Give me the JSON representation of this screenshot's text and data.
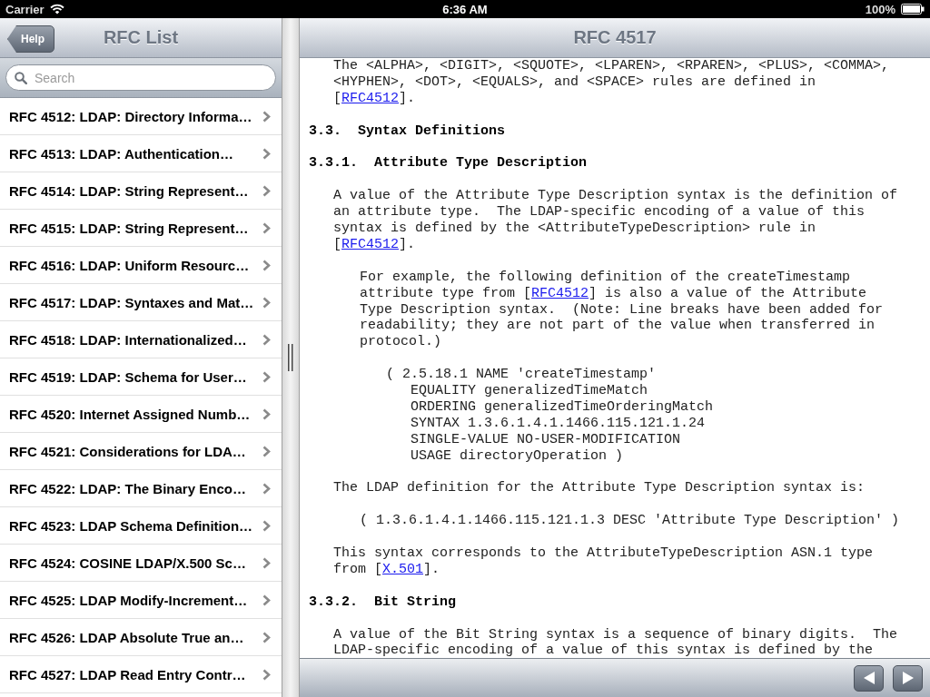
{
  "status_bar": {
    "carrier": "Carrier",
    "time": "6:36 AM",
    "battery": "100%"
  },
  "master": {
    "title": "RFC List",
    "back_button": "Help",
    "search": {
      "placeholder": "Search"
    },
    "items": [
      "RFC 4512: LDAP: Directory Informa…",
      "RFC 4513: LDAP: Authentication…",
      "RFC 4514: LDAP: String Represent…",
      "RFC 4515: LDAP: String Represent…",
      "RFC 4516: LDAP: Uniform Resourc…",
      "RFC 4517: LDAP: Syntaxes and Mat…",
      "RFC 4518: LDAP: Internationalized…",
      "RFC 4519: LDAP: Schema for User…",
      "RFC 4520: Internet Assigned Numb…",
      "RFC 4521: Considerations for LDA…",
      "RFC 4522: LDAP: The Binary Enco…",
      "RFC 4523: LDAP Schema Definition…",
      "RFC 4524: COSINE LDAP/X.500 Sc…",
      "RFC 4525: LDAP Modify-Increment…",
      "RFC 4526: LDAP Absolute True an…",
      "RFC 4527: LDAP Read Entry Contr…"
    ]
  },
  "detail": {
    "title": "RFC 4517",
    "blocks": [
      {
        "kind": "text",
        "parts": [
          {
            "text": "The <ALPHA>, <DIGIT>, <SQUOTE>, <LPAREN>, <RPAREN>, <PLUS>, <COMMA>,\n<HYPHEN>, <DOT>, <EQUALS>, and <SPACE> rules are defined in\n["
          },
          {
            "link": "RFC4512"
          },
          {
            "text": "]."
          }
        ]
      },
      {
        "kind": "heading",
        "parts": [
          {
            "text": "3.3.  Syntax Definitions"
          }
        ]
      },
      {
        "kind": "heading",
        "parts": [
          {
            "text": "3.3.1.  Attribute Type Description"
          }
        ]
      },
      {
        "kind": "text",
        "parts": [
          {
            "text": "A value of the Attribute Type Description syntax is the definition of\nan attribute type.  The LDAP-specific encoding of a value of this\nsyntax is defined by the <AttributeTypeDescription> rule in\n["
          },
          {
            "link": "RFC4512"
          },
          {
            "text": "]."
          }
        ]
      },
      {
        "kind": "note",
        "parts": [
          {
            "text": "For example, the following definition of the createTimestamp\nattribute type from ["
          },
          {
            "link": "RFC4512"
          },
          {
            "text": "] is also a value of the Attribute\nType Description syntax.  (Note: Line breaks have been added for\nreadability; they are not part of the value when transferred in\nprotocol.)"
          }
        ]
      },
      {
        "kind": "example",
        "parts": [
          {
            "text": "( 2.5.18.1 NAME 'createTimestamp'\n   EQUALITY generalizedTimeMatch\n   ORDERING generalizedTimeOrderingMatch\n   SYNTAX 1.3.6.1.4.1.1466.115.121.1.24\n   SINGLE-VALUE NO-USER-MODIFICATION\n   USAGE directoryOperation )"
          }
        ]
      },
      {
        "kind": "text",
        "parts": [
          {
            "text": "The LDAP definition for the Attribute Type Description syntax is:"
          }
        ]
      },
      {
        "kind": "note",
        "parts": [
          {
            "text": "( 1.3.6.1.4.1.1466.115.121.1.3 DESC 'Attribute Type Description' )"
          }
        ]
      },
      {
        "kind": "text",
        "parts": [
          {
            "text": "This syntax corresponds to the AttributeTypeDescription ASN.1 type\nfrom ["
          },
          {
            "link": "X.501"
          },
          {
            "text": "]."
          }
        ]
      },
      {
        "kind": "heading",
        "parts": [
          {
            "text": "3.3.2.  Bit String"
          }
        ]
      },
      {
        "kind": "text",
        "parts": [
          {
            "text": "A value of the Bit String syntax is a sequence of binary digits.  The\nLDAP-specific encoding of a value of this syntax is defined by the"
          }
        ]
      }
    ]
  }
}
